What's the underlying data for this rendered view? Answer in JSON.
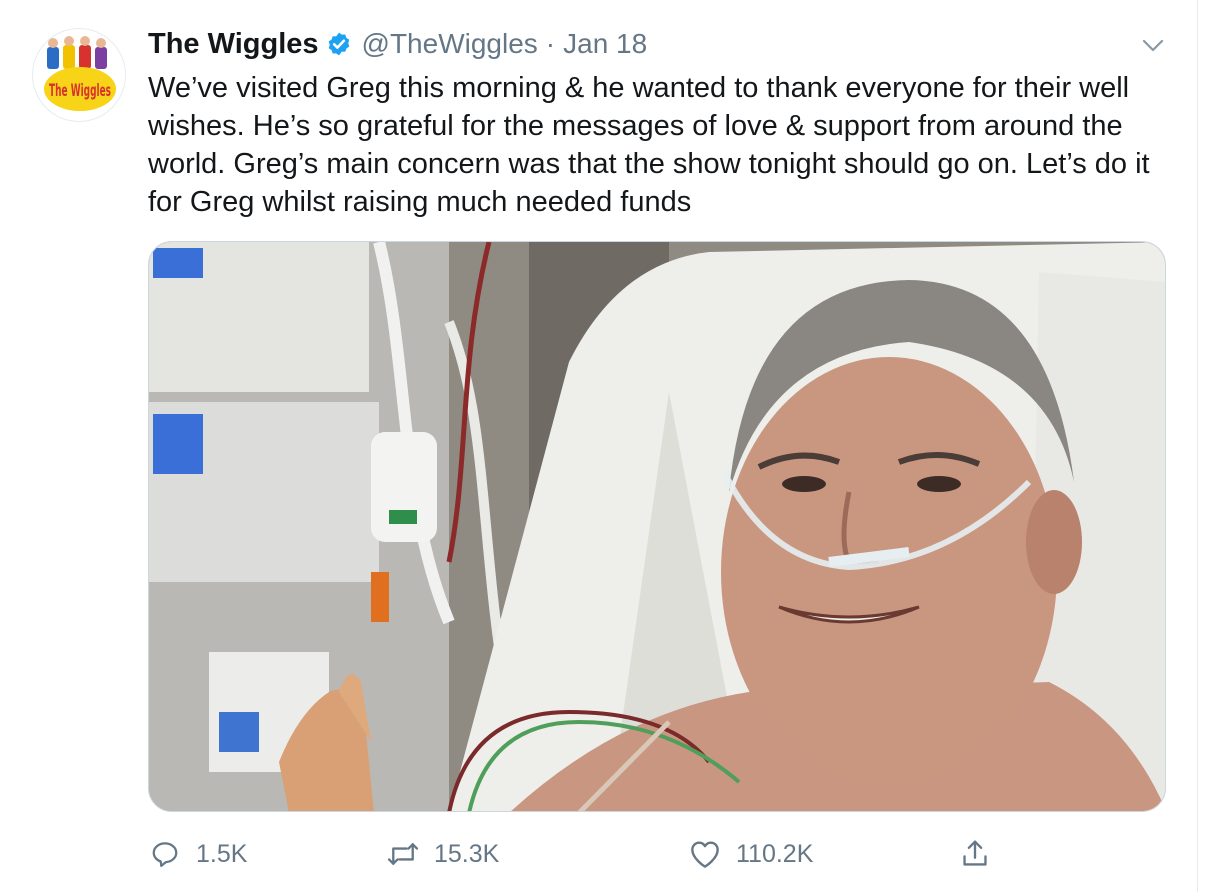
{
  "tweet": {
    "display_name": "The Wiggles",
    "handle": "@TheWiggles",
    "separator": "·",
    "date": "Jan 18",
    "text": "We’ve visited Greg this morning & he wanted to thank everyone for their well wishes. He’s so grateful for the messages of love & support from around the world. Greg’s main concern was that the show tonight should go on. Let’s do it for Greg whilst raising much needed funds",
    "avatar_logo_text": "The Wiggles"
  },
  "actions": {
    "reply_count": "1.5K",
    "retweet_count": "15.3K",
    "like_count": "110.2K"
  },
  "icons": {
    "verified": "verified-badge-icon",
    "caret": "chevron-down-icon",
    "reply": "speech-bubble-icon",
    "retweet": "retweet-arrows-icon",
    "like": "heart-outline-icon",
    "share": "share-upload-icon"
  },
  "colors": {
    "accent": "#1da1f2",
    "text_primary": "#14171a",
    "text_secondary": "#657786",
    "border": "#e6ecf0"
  }
}
